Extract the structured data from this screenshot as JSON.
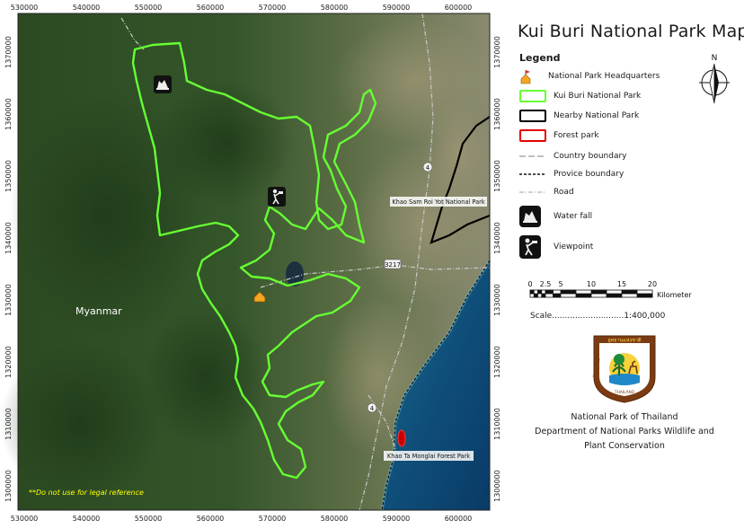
{
  "map": {
    "title": "Kui Buri National Park Map",
    "x_ticks": [
      "530000",
      "540000",
      "550000",
      "560000",
      "570000",
      "580000",
      "590000",
      "600000"
    ],
    "y_ticks": [
      "1370000",
      "1360000",
      "1350000",
      "1340000",
      "1330000",
      "1320000",
      "1310000",
      "1300000"
    ],
    "labels": {
      "myanmar": "Myanmar",
      "sam_roi_yot": "Khao Sam Roi Yot National Park",
      "ta_mong_lai": "Khao Ta Monglai Forest Park",
      "road_3217": "3217",
      "road_4a": "4",
      "road_4b": "4",
      "disclaimer": "**Do not use for legal reference"
    }
  },
  "legend": {
    "heading": "Legend",
    "items": [
      {
        "label": "National Park Headquarters",
        "icon": "headquarters-icon"
      },
      {
        "label": "Kui Buri National Park",
        "icon": "kui-buri-boundary-swatch",
        "color": "#66ff33"
      },
      {
        "label": "Nearby National Park",
        "icon": "nearby-park-swatch",
        "color": "#000000"
      },
      {
        "label": "Forest park",
        "icon": "forest-park-swatch",
        "color": "#e60000"
      },
      {
        "label": "Country boundary",
        "icon": "country-boundary-line"
      },
      {
        "label": "Provice boundary",
        "icon": "province-boundary-line"
      },
      {
        "label": "Road",
        "icon": "road-line"
      },
      {
        "label": "Water fall",
        "icon": "waterfall-icon"
      },
      {
        "label": "Viewpoint",
        "icon": "viewpoint-icon"
      }
    ]
  },
  "north": {
    "label": "N"
  },
  "scale": {
    "ticks": [
      "0",
      "2.5",
      "5",
      "10",
      "15",
      "20"
    ],
    "unit": "Kilometer",
    "text": "Scale............................1:400,000"
  },
  "logo": {
    "top_text": "อุทยานแห่งชาติ",
    "left_text": "NATIONAL",
    "right_text": "PARK",
    "bottom_text": "THAILAND"
  },
  "credits": {
    "line1": "National Park of Thailand",
    "line2": "Department of National Parks Wildlife and",
    "line3": "Plant Conservation"
  },
  "colors": {
    "park_boundary": "#66ff33",
    "nearby_park": "#000000",
    "forest_park": "#e60000",
    "headquarters": "#f5a623",
    "disclaimer": "#ffff00"
  }
}
